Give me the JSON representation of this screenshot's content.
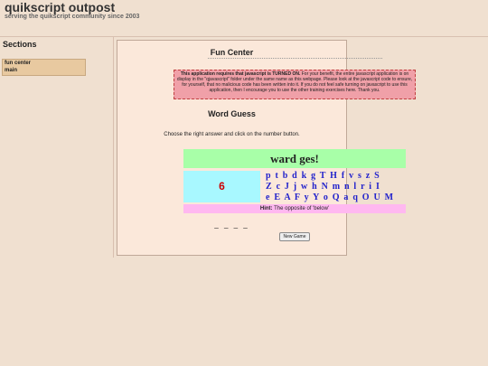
{
  "header": {
    "title": "quikscript outpost",
    "tagline": "serving the quikscript community since 2003"
  },
  "sidebar": {
    "heading": "Sections",
    "items": [
      {
        "label": "fun center"
      },
      {
        "label": "main"
      }
    ]
  },
  "main": {
    "title": "Fun Center",
    "notice": {
      "bold": "This application requires that javascript is TURNED ON.",
      "text": " For your benefit, the entire javascript application is on display in the \"qjavascript\" folder under the same name as this webpage. Please look at the javascript code to ensure, for yourself, that no malicious code has been written into it. If you do not feel safe turning on javascript to use this application, then I encourage you to use the other training exercises here. Thank you."
    },
    "game_title": "Word Guess",
    "instructions": "Choose the right answer and click on the number button.",
    "game": {
      "banner": "ward ges!",
      "tries_left": "6",
      "letter_rows": [
        "p t b d k g T H f v s z S",
        "Z c J j w h N m n l r i I",
        "e E A F y Y o Q a q O U M"
      ],
      "hint_label": "Hint:",
      "hint_text": " The opposite of 'below'",
      "blanks": "_ _ _ _",
      "new_game_label": "New Game"
    }
  }
}
